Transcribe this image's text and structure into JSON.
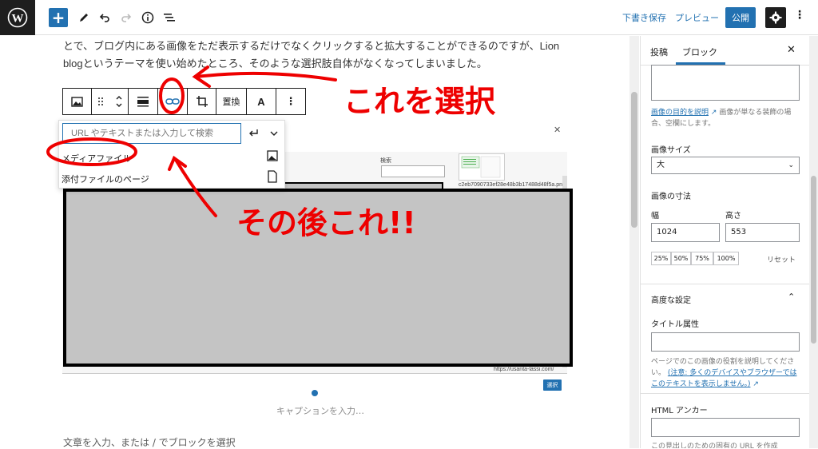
{
  "topbar": {
    "draft_label": "下書き保存",
    "preview_label": "プレビュー",
    "publish_label": "公開"
  },
  "editor": {
    "paragraph": "とで、ブログ内にある画像をただ表示するだけでなくクリックすると拡大することができるのですが、Lion blogというテーマを使い始めたところ、そのような選択肢自体がなくなってしまいました。",
    "toolbar": {
      "replace_label": "置換",
      "text_label": "A"
    },
    "link_popover": {
      "search_placeholder": "URL やテキストまたは入力して検索",
      "option_media": "メディアファイル",
      "option_attachment": "添付ファイルのページ"
    },
    "image": {
      "search_label": "検索",
      "thumb_filename": "c2eb7090733ef28e48b3b17488d48f5a.png",
      "status_url": "https://usanta-lassi.com/",
      "select_label": "選択"
    },
    "caption_placeholder": "キャプションを入力…",
    "next_block_placeholder": "文章を入力、または / でブロックを選択"
  },
  "annotations": {
    "select_this": "これを選択",
    "then_this": "その後これ!!"
  },
  "sidebar": {
    "tab_post": "投稿",
    "tab_block": "ブロック",
    "alt_help_link": "画像の目的を説明",
    "alt_help_rest": "画像が単なる装飾の場合、空欄にします。",
    "size_label": "画像サイズ",
    "size_value": "大",
    "dimensions_label": "画像の寸法",
    "width_label": "幅",
    "height_label": "高さ",
    "width_value": "1024",
    "height_value": "553",
    "pct_25": "25%",
    "pct_50": "50%",
    "pct_75": "75%",
    "pct_100": "100%",
    "reset_label": "リセット",
    "advanced_label": "高度な設定",
    "title_attr_label": "タイトル属性",
    "title_help": "ページでのこの画像の役割を説明してください。",
    "title_help_link": "(注意: 多くのデバイスやブラウザーではこのテキストを表示しません。)",
    "html_anchor_label": "HTML アンカー",
    "anchor_help": "この見出しのための固有の URL を作成"
  },
  "colors": {
    "accent": "#2271b1",
    "annotation": "#e00000",
    "dark": "#1e1e1e"
  }
}
